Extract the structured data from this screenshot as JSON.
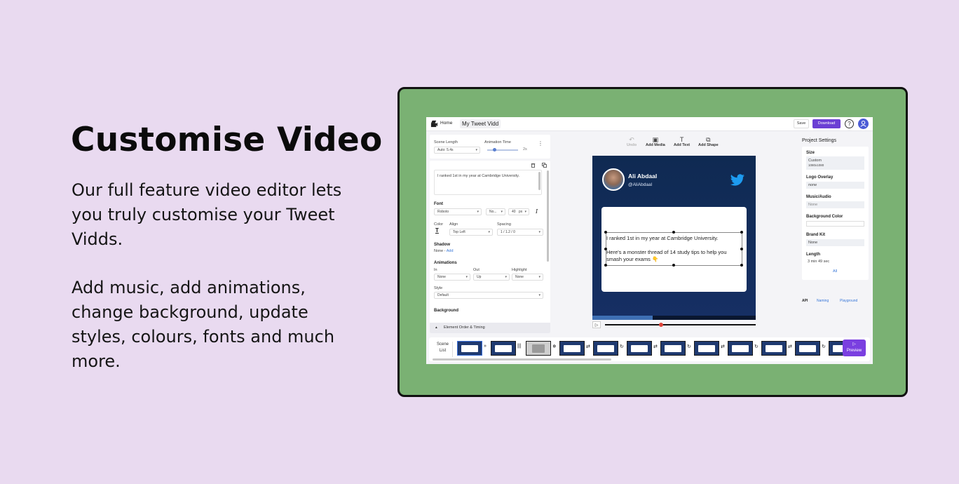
{
  "hero": {
    "title": "Customise Video",
    "paragraph1": "Our full feature video editor lets you truly customise your Tweet Vidds.",
    "paragraph2": "Add music, add animations, change background, update styles, colours, fonts and much more."
  },
  "colors": {
    "page_bg": "#e9daf0",
    "frame_bg": "#7ab173",
    "accent": "#6b3fd4",
    "video_bg": "#162f64"
  },
  "app": {
    "topbar": {
      "home_label": "Home",
      "project_name": "My Tweet Vidd",
      "save_label": "Save",
      "download_label": "Download",
      "help_glyph": "?",
      "icons": [
        "logo-icon",
        "help-icon",
        "user-avatar-icon"
      ]
    },
    "scene_settings": {
      "scene_length_label": "Scene Length",
      "scene_length_value": "Auto: 5.4s",
      "animation_time_label": "Animation Time",
      "animation_time_value": "2s"
    },
    "text_editor": {
      "content": "I ranked 1st in my year at Cambridge University."
    },
    "font": {
      "section_label": "Font",
      "family": "Roboto",
      "weight": "No...",
      "size": "40",
      "unit": "px",
      "italic_glyph": "I"
    },
    "color_align": {
      "color_label": "Color",
      "color_glyph": "T",
      "align_label": "Align",
      "align_value": "Top Left",
      "spacing_label": "Spacing",
      "spacing_value": "1 / 1.2 / 0"
    },
    "shadow": {
      "label": "Shadow",
      "value": "None",
      "separator": " - ",
      "add_label": "Add"
    },
    "animations": {
      "label": "Animations",
      "in_label": "In",
      "in_value": "None",
      "out_label": "Out",
      "out_value": "Up",
      "highlight_label": "Highlight",
      "highlight_value": "None",
      "style_label": "Style",
      "style_value": "Default"
    },
    "background": {
      "label": "Background"
    },
    "element_order": {
      "chevron_glyph": "▴",
      "label": "Element Order & Timing"
    },
    "toolbar": {
      "undo_label": "Undo",
      "undo_glyph": "↶",
      "add_media_label": "Add Media",
      "add_media_glyph": "▣",
      "add_text_label": "Add Text",
      "add_text_glyph": "T",
      "add_shape_label": "Add Shape",
      "add_shape_glyph": "⧉"
    },
    "video": {
      "author_name": "Ali Abdaal",
      "author_handle": "@AliAbdaal",
      "tweet_text": "I ranked 1st in my year at Cambridge University.\n\nHere's a monster thread of 14 study tips to help you smash your exams 👇",
      "progress_fraction": 0.37,
      "seek_fraction": 0.37,
      "play_glyph": "▷"
    },
    "project_settings": {
      "title": "Project Settings",
      "size_label": "Size",
      "size_value": "Custom",
      "size_dims": "1080x1080",
      "logo_label": "Logo Overlay",
      "logo_value": "none",
      "music_label": "Music/Audio",
      "music_value": "None",
      "bgcolor_label": "Background Color",
      "brand_label": "Brand Kit",
      "brand_value": "None",
      "length_label": "Length",
      "length_value": "3 min 49 sec",
      "all_label": "All",
      "api_label": "API",
      "naming_label": "Naming",
      "playground_label": "Playground"
    },
    "scene_bar": {
      "scene_label_line1": "Scene",
      "scene_label_line2": "List",
      "preview_label": "Preview",
      "preview_glyph": "▷",
      "transitions": [
        "»",
        "|||",
        "❄",
        "⇄",
        "↻",
        "⇄",
        "↻",
        "⇄",
        "↻",
        "⇄",
        "↻"
      ]
    }
  }
}
